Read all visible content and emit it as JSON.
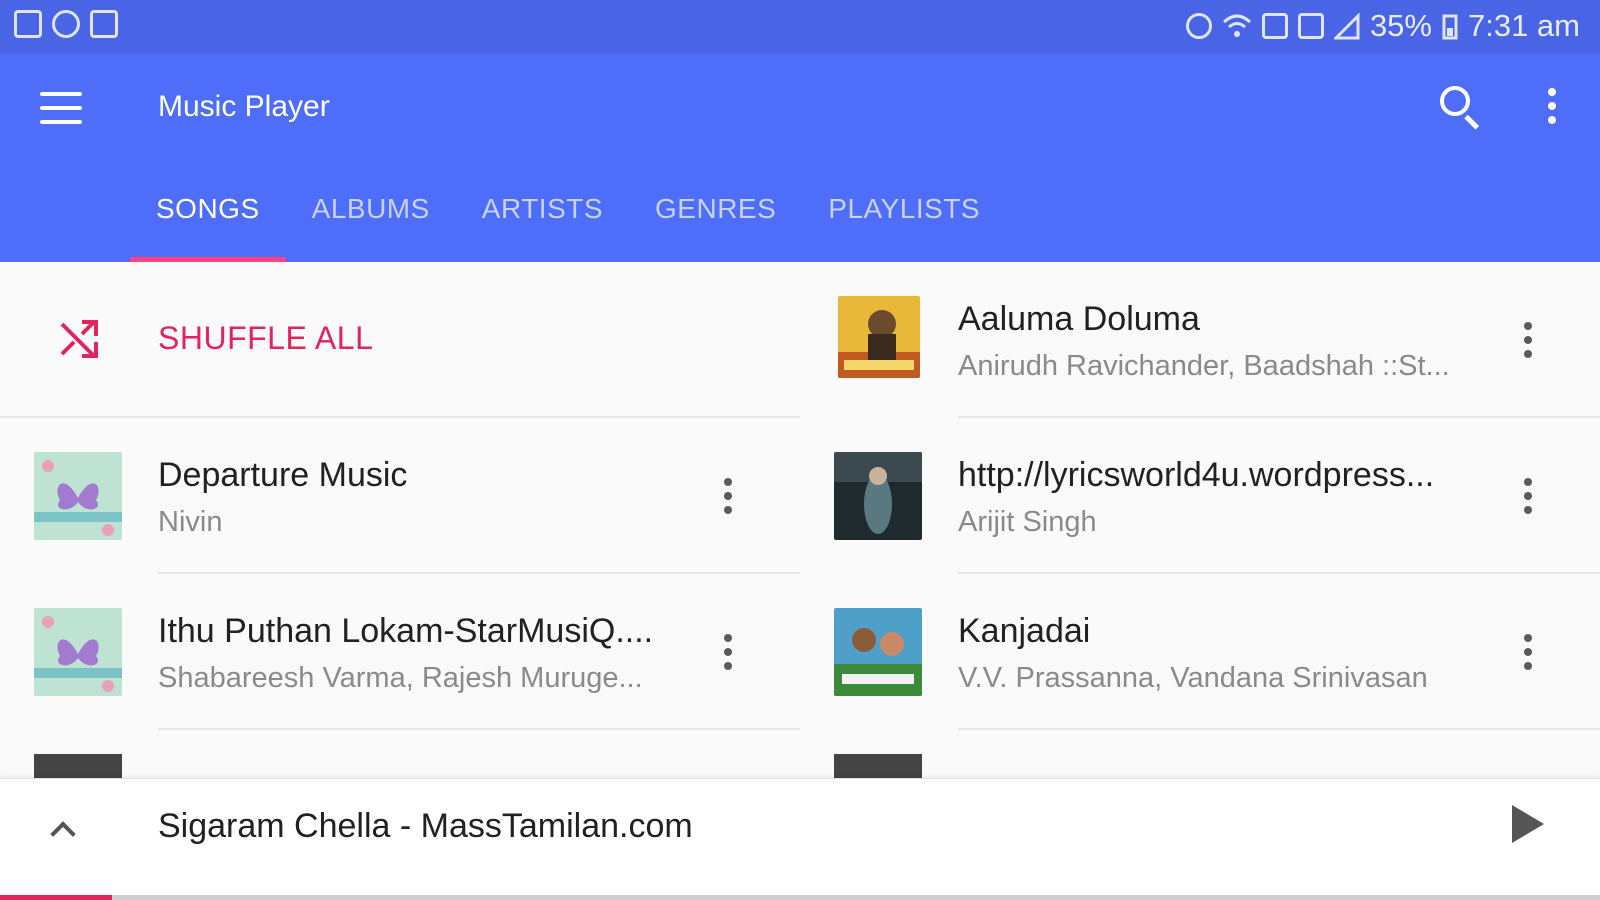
{
  "status_bar": {
    "battery": "35%",
    "time": "7:31 am",
    "left_icons": [
      "gallery-icon",
      "chrome-icon",
      "usb-icon"
    ],
    "right_icons": [
      "alarm-icon",
      "wifi-icon",
      "nfc-icon",
      "no-sim-icon",
      "signal-icon",
      "battery-icon"
    ]
  },
  "app_bar": {
    "title": "Music Player",
    "menu_icon": "hamburger-menu-icon",
    "search_icon": "search-icon",
    "more_icon": "more-vert-icon",
    "color": "#4e6df8"
  },
  "tabs": [
    {
      "label": "SONGS",
      "active": true
    },
    {
      "label": "ALBUMS",
      "active": false
    },
    {
      "label": "ARTISTS",
      "active": false
    },
    {
      "label": "GENRES",
      "active": false
    },
    {
      "label": "PLAYLISTS",
      "active": false
    }
  ],
  "shuffle": {
    "label": "SHUFFLE ALL",
    "icon": "shuffle-icon",
    "color": "#e0245e"
  },
  "songs": [
    {
      "title": "Aaluma Doluma",
      "artist": "Anirudh Ravichander, Baadshah ::St...",
      "art": "album-art-aaluma"
    },
    {
      "title": "Departure Music",
      "artist": "Nivin",
      "art": "album-art-departure"
    },
    {
      "title": "http://lyricsworld4u.wordpress...",
      "artist": "Arijit Singh",
      "art": "album-art-lyricsworld"
    },
    {
      "title": "Ithu Puthan Lokam-StarMusiQ....",
      "artist": "Shabareesh Varma, Rajesh Muruge...",
      "art": "album-art-ithu-puthan"
    },
    {
      "title": "Kanjadai",
      "artist": "V.V. Prassanna, Vandana Srinivasan",
      "art": "album-art-kanjadai"
    }
  ],
  "now_playing": {
    "title": "Sigaram Chella - MassTamilan.com",
    "expand_icon": "chevron-up-icon",
    "play_icon": "play-icon",
    "progress": 0.07
  },
  "accent_color": "#ff4081"
}
